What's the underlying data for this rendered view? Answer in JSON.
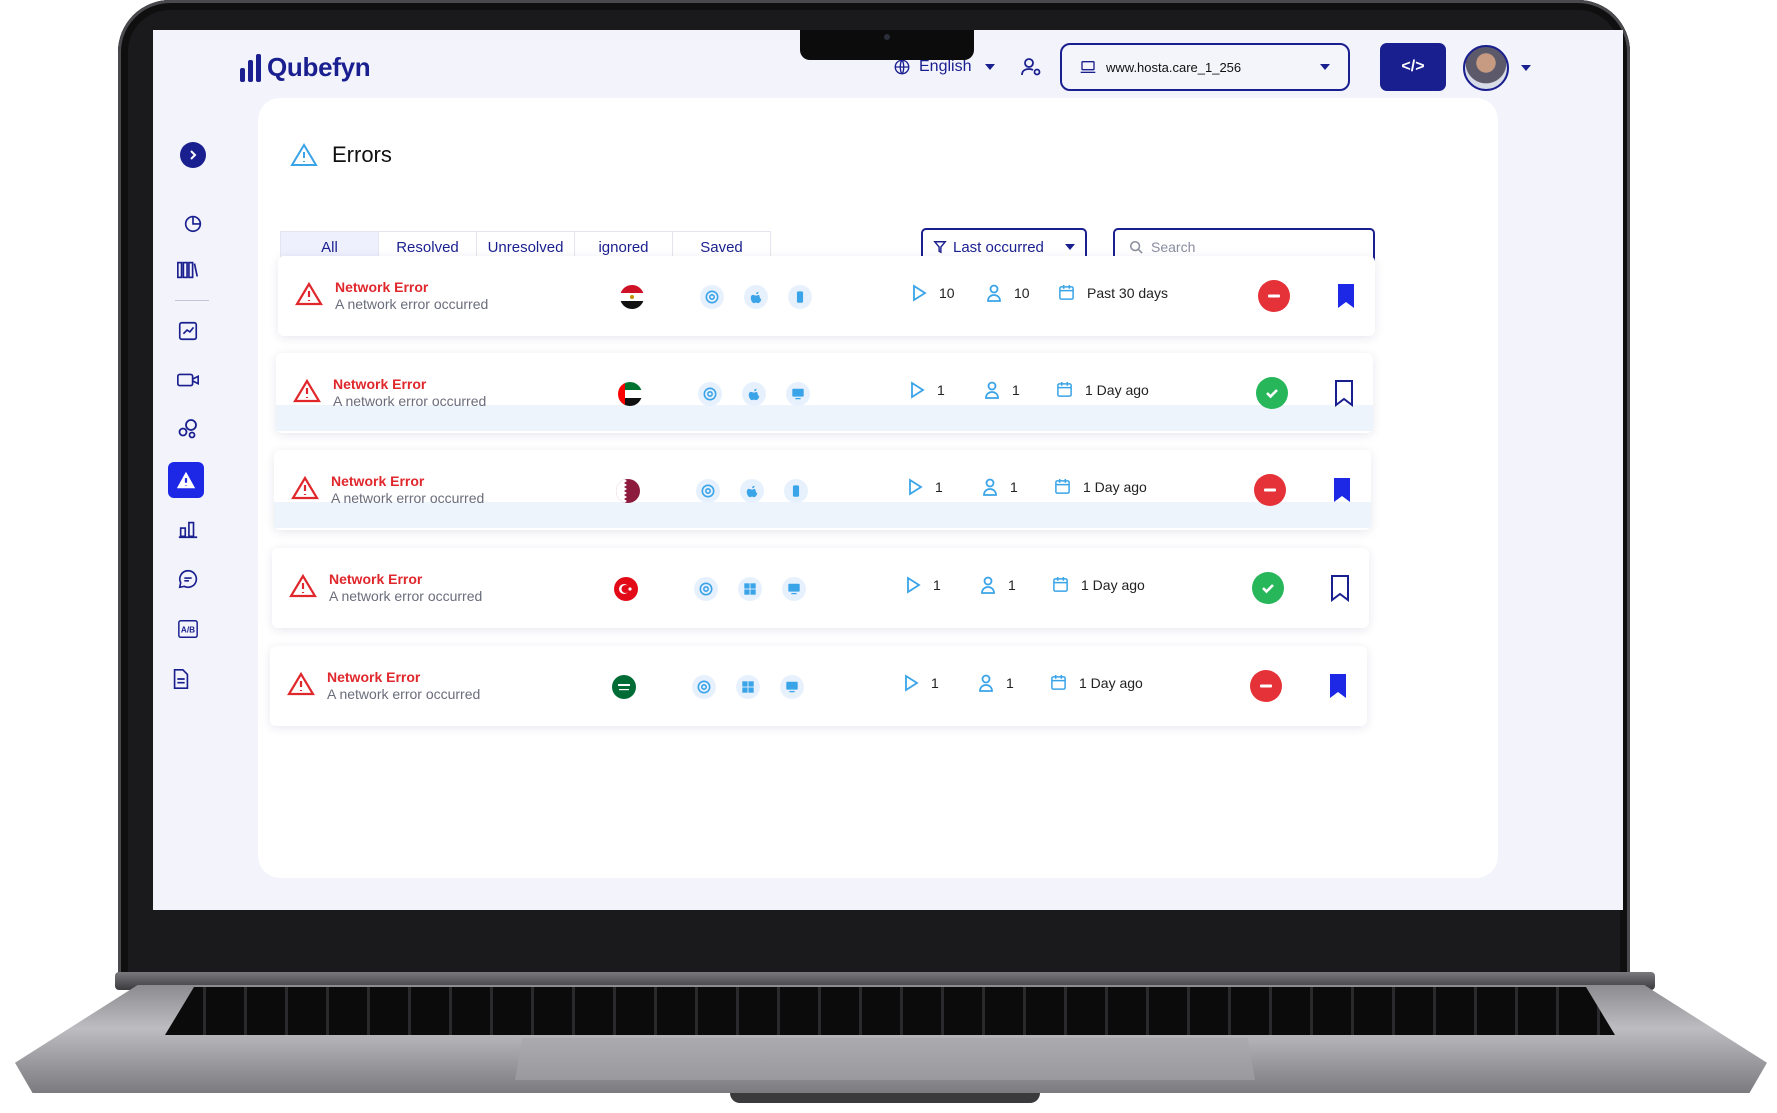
{
  "app": {
    "name": "Qubefyn"
  },
  "header": {
    "language": "English",
    "site": "www.hosta.care_1_256",
    "code_button": "</>"
  },
  "page": {
    "title": "Errors"
  },
  "tabs": [
    "All",
    "Resolved",
    "Unresolved",
    "ignored",
    "Saved"
  ],
  "active_tab": "All",
  "filter": {
    "label": "Last occurred"
  },
  "search": {
    "placeholder": "Search"
  },
  "sidebar": {
    "items": [
      "analytics-icon",
      "library-icon",
      "trend-icon",
      "video-icon",
      "segments-icon",
      "errors-icon",
      "stats-icon",
      "chat-icon",
      "ab-test-icon",
      "report-icon"
    ],
    "active": "errors-icon"
  },
  "colors": {
    "primary": "#1a1f8f",
    "accent": "#1c28e6",
    "error": "#e0272c",
    "success": "#27b65a"
  },
  "errors": [
    {
      "title": "Network Error",
      "description": "A network error occurred",
      "flag": "egypt-flag-icon",
      "devices": [
        "chrome-icon",
        "apple-icon",
        "mobile-icon"
      ],
      "sessions": "10",
      "users": "10",
      "time": "Past 30 days",
      "status": "unresolved",
      "saved": true
    },
    {
      "title": "Network Error",
      "description": "A network error occurred",
      "flag": "uae-flag-icon",
      "devices": [
        "chrome-icon",
        "apple-icon",
        "desktop-icon"
      ],
      "sessions": "1",
      "users": "1",
      "time": "1 Day ago",
      "status": "resolved",
      "saved": false
    },
    {
      "title": "Network Error",
      "description": "A network error occurred",
      "flag": "qatar-flag-icon",
      "devices": [
        "chrome-icon",
        "apple-icon",
        "mobile-icon"
      ],
      "sessions": "1",
      "users": "1",
      "time": "1 Day ago",
      "status": "unresolved",
      "saved": true
    },
    {
      "title": "Network Error",
      "description": "A network error occurred",
      "flag": "turkey-flag-icon",
      "devices": [
        "chrome-icon",
        "windows-icon",
        "desktop-icon"
      ],
      "sessions": "1",
      "users": "1",
      "time": "1 Day ago",
      "status": "resolved",
      "saved": false
    },
    {
      "title": "Network Error",
      "description": "A network error occurred",
      "flag": "saudi-flag-icon",
      "devices": [
        "chrome-icon",
        "windows-icon",
        "desktop-icon"
      ],
      "sessions": "1",
      "users": "1",
      "time": "1 Day ago",
      "status": "unresolved",
      "saved": true
    }
  ]
}
